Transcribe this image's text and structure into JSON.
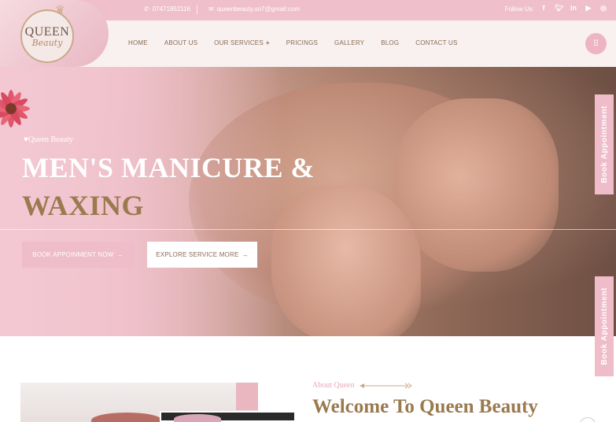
{
  "topbar": {
    "phone": "07471852116",
    "email": "queenbeauty.so7@gmail.com",
    "follow_label": "Follow Us:",
    "socials": [
      "f",
      "t",
      "in",
      "yt",
      "ig"
    ]
  },
  "logo": {
    "line1": "QUEEN",
    "line2": "Beauty"
  },
  "nav": {
    "items": [
      "HOME",
      "ABOUT US",
      "OUR SERVICES",
      "PRICINGS",
      "GALLERY",
      "BLOG",
      "CONTACT US"
    ],
    "services_plus": "+"
  },
  "hero": {
    "tagline": "Queen Beauty",
    "title_line1": "MEN'S MANICURE &",
    "title_line2": "WAXING",
    "book_button": "BOOK APPOINMENT NOW",
    "explore_button": "EXPLORE SERVICE MORE",
    "arrow": "→"
  },
  "side_tabs": {
    "label": "Book Appointment"
  },
  "about": {
    "label": "About Queen",
    "title": "Welcome To Queen Beauty"
  },
  "colors": {
    "pink": "#efbcc9",
    "gold": "#9a7a4e",
    "cream": "#f8f1ef",
    "text_brown": "#8a6a55"
  },
  "icons": [
    "phone-icon",
    "email-icon",
    "menu-grid-icon",
    "arrow-right-icon",
    "crown-icon",
    "flower-icon"
  ]
}
